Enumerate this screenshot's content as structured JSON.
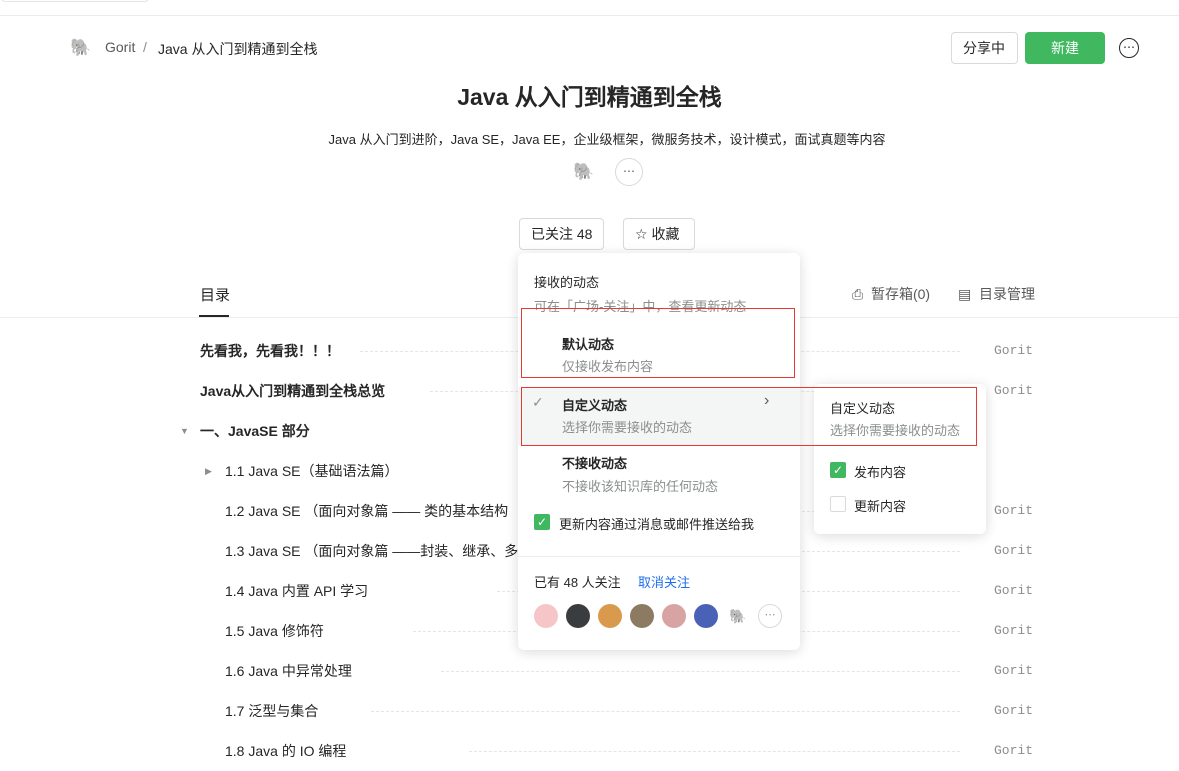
{
  "breadcrumb": {
    "user": "Gorit",
    "sep": "/",
    "book": "Java 从入门到精通到全栈"
  },
  "header": {
    "share": "分享中",
    "new": "新建",
    "more": "⋯"
  },
  "book": {
    "title": "Java 从入门到精通到全栈",
    "desc": "Java 从入门到进阶，Java SE，Java EE，企业级框架，微服务技术，设计模式，面试真题等内容",
    "followed": "已关注 48",
    "collect": "收藏"
  },
  "tabs": {
    "toc": "目录",
    "drafts": "暂存箱(0)",
    "manage": "目录管理"
  },
  "toc": [
    {
      "title": "先看我，先看我！！！",
      "author": "Gorit",
      "bold": true
    },
    {
      "title": "Java从入门到精通到全栈总览",
      "author": "Gorit",
      "bold": true
    },
    {
      "title": "一、JavaSE 部分",
      "author": "",
      "bold": true
    },
    {
      "title": "1.1 Java SE（基础语法篇）",
      "author": ""
    },
    {
      "title": "1.2 Java SE （面向对象篇 —— 类的基本结构",
      "author": "Gorit"
    },
    {
      "title": "1.3 Java SE （面向对象篇 ——封装、继承、多",
      "author": "Gorit"
    },
    {
      "title": "1.4 Java 内置 API 学习",
      "author": "Gorit"
    },
    {
      "title": "1.5 Java 修饰符",
      "author": "Gorit"
    },
    {
      "title": "1.6 Java 中异常处理",
      "author": "Gorit"
    },
    {
      "title": "1.7 泛型与集合",
      "author": "Gorit"
    },
    {
      "title": "1.8 Java 的 IO 编程",
      "author": "Gorit"
    }
  ],
  "popover": {
    "heading": "接收的动态",
    "hint": "可在「广场-关注」中，查看更新动态",
    "options": [
      {
        "title": "默认动态",
        "desc": "仅接收发布内容"
      },
      {
        "title": "自定义动态",
        "desc": "选择你需要接收的动态"
      },
      {
        "title": "不接收动态",
        "desc": "不接收该知识库的任何动态"
      }
    ],
    "push": "更新内容通过消息或邮件推送给我",
    "count": "已有 48 人关注",
    "unfollow": "取消关注"
  },
  "submenu": {
    "title": "自定义动态",
    "desc": "选择你需要接收的动态",
    "publish": "发布内容",
    "update": "更新内容"
  },
  "colors": {
    "accent": "#3fb860",
    "link": "#1f6feb",
    "highlight": "#e53935"
  }
}
